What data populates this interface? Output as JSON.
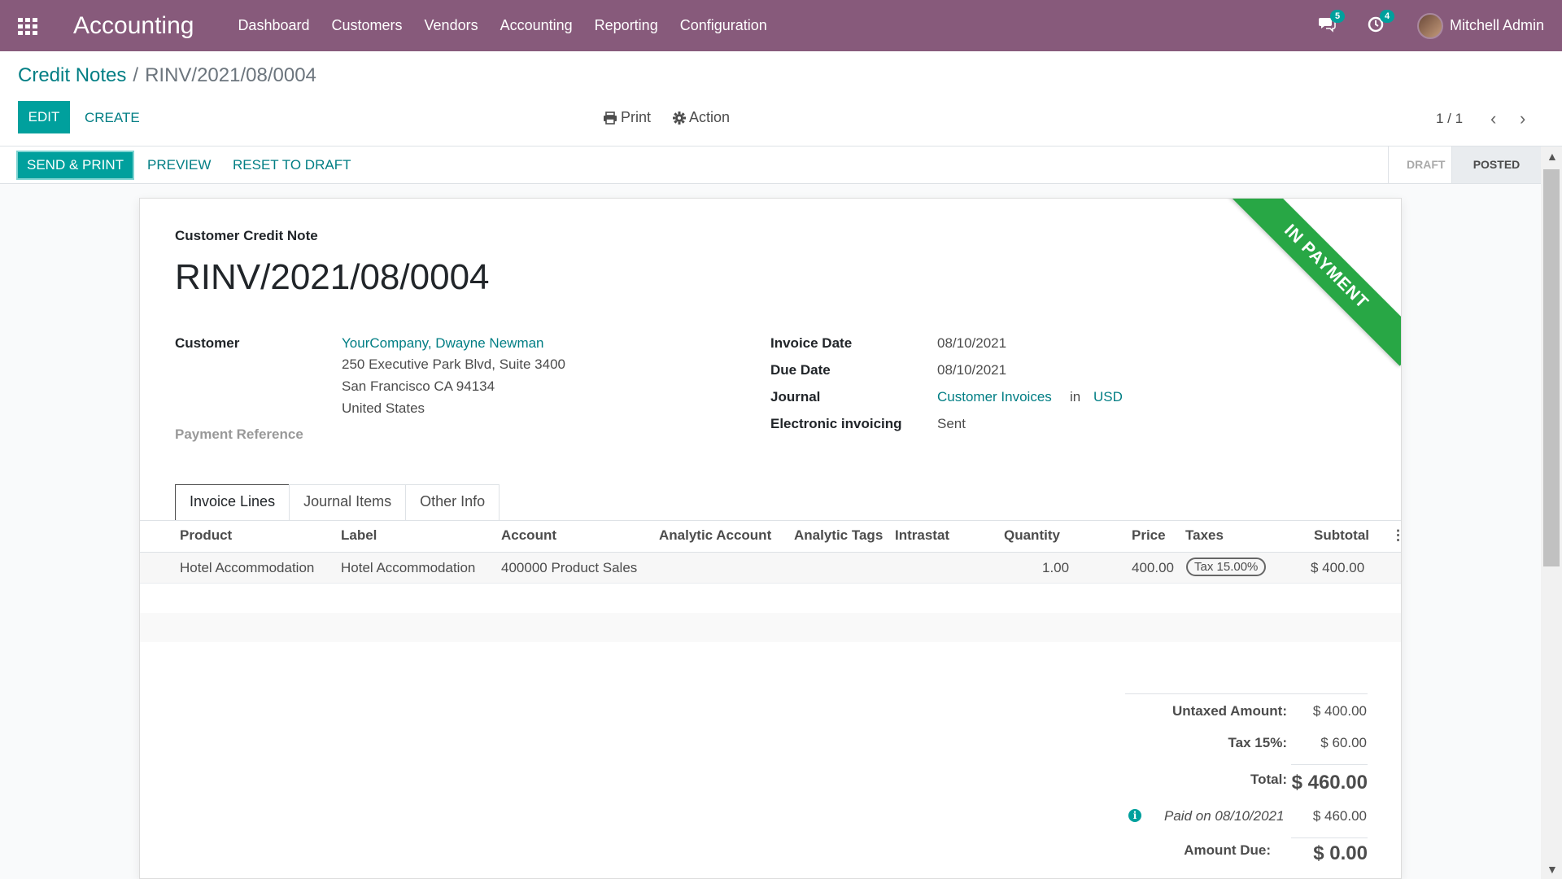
{
  "navbar": {
    "brand": "Accounting",
    "menu": [
      "Dashboard",
      "Customers",
      "Vendors",
      "Accounting",
      "Reporting",
      "Configuration"
    ],
    "messages_count": "5",
    "activities_count": "4",
    "user_name": "Mitchell Admin",
    "color": "#875a7b"
  },
  "control": {
    "breadcrumb_parent": "Credit Notes",
    "breadcrumb_sep": "/",
    "breadcrumb_current": "RINV/2021/08/0004",
    "edit_label": "EDIT",
    "create_label": "CREATE",
    "print_label": "Print",
    "action_label": "Action",
    "pager": "1 / 1"
  },
  "statusbar": {
    "send_print_label": "SEND & PRINT",
    "preview_label": "PREVIEW",
    "reset_label": "RESET TO DRAFT",
    "steps": [
      "DRAFT",
      "POSTED"
    ],
    "active_step": "POSTED"
  },
  "sheet": {
    "ribbon": "IN PAYMENT",
    "ribbon_color": "#28a745",
    "doc_type": "Customer Credit Note",
    "doc_name": "RINV/2021/08/0004",
    "customer_label": "Customer",
    "customer_name": "YourCompany, Dwayne Newman",
    "customer_address": [
      "250 Executive Park Blvd, Suite 3400",
      "San Francisco CA 94134",
      "United States"
    ],
    "payment_ref_label": "Payment Reference",
    "invoice_date_label": "Invoice Date",
    "invoice_date": "08/10/2021",
    "due_date_label": "Due Date",
    "due_date": "08/10/2021",
    "journal_label": "Journal",
    "journal": "Customer Invoices",
    "journal_in": "in",
    "currency": "USD",
    "einvoicing_label": "Electronic invoicing",
    "einvoicing": "Sent"
  },
  "tabs": [
    "Invoice Lines",
    "Journal Items",
    "Other Info"
  ],
  "table": {
    "headers": [
      "Product",
      "Label",
      "Account",
      "Analytic Account",
      "Analytic Tags",
      "Intrastat",
      "Quantity",
      "Price",
      "Taxes",
      "Subtotal"
    ],
    "rows": [
      {
        "product": "Hotel Accommodation",
        "label": "Hotel Accommodation",
        "account": "400000 Product Sales",
        "quantity": "1.00",
        "price": "400.00",
        "tax": "Tax 15.00%",
        "subtotal": "$ 400.00"
      }
    ]
  },
  "totals": {
    "untaxed_label": "Untaxed Amount:",
    "untaxed": "$ 400.00",
    "tax_label": "Tax 15%:",
    "tax": "$ 60.00",
    "total_label": "Total:",
    "total": "$ 460.00",
    "paid_label": "Paid on 08/10/2021",
    "paid": "$ 460.00",
    "due_label": "Amount Due:",
    "due": "$ 0.00"
  }
}
